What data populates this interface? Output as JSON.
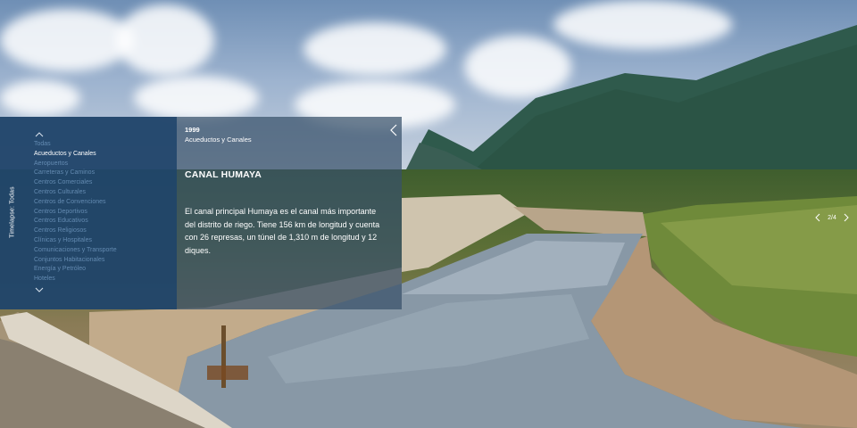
{
  "sidebar": {
    "label": "Timelapse: Todas"
  },
  "nav": {
    "up_icon": "chevron-up-icon",
    "down_icon": "chevron-down-icon",
    "categories": [
      "Todas",
      "Acueductos y Canales",
      "Aeropuertos",
      "Carreteras y Caminos",
      "Centros Comerciales",
      "Centros Culturales",
      "Centros de Convenciones",
      "Centros Deportivos",
      "Centros Educativos",
      "Centros Religiosos",
      "Clínicas y Hospitales",
      "Comunicaciones y Transporte",
      "Conjuntos Habitacionales",
      "Energía y Petróleo",
      "Hoteles"
    ],
    "active_index": 1
  },
  "content": {
    "year": "1999",
    "category": "Acueductos y Canales",
    "title": "CANAL HUMAYA",
    "description": "El canal principal Humaya es el canal más importante del distrito de riego. Tiene 156 km de longitud y cuenta con 26 represas, un túnel de 1,310 m de longitud y 12 diques.",
    "close_icon": "chevron-left-icon"
  },
  "pager": {
    "counter": "2/4",
    "prev_icon": "chevron-left-icon",
    "next_icon": "chevron-right-icon"
  },
  "colors": {
    "panel": "#20456a",
    "content_overlay": "#374f69",
    "active_text": "#ffffff",
    "inactive_text": "#78a0c8"
  }
}
